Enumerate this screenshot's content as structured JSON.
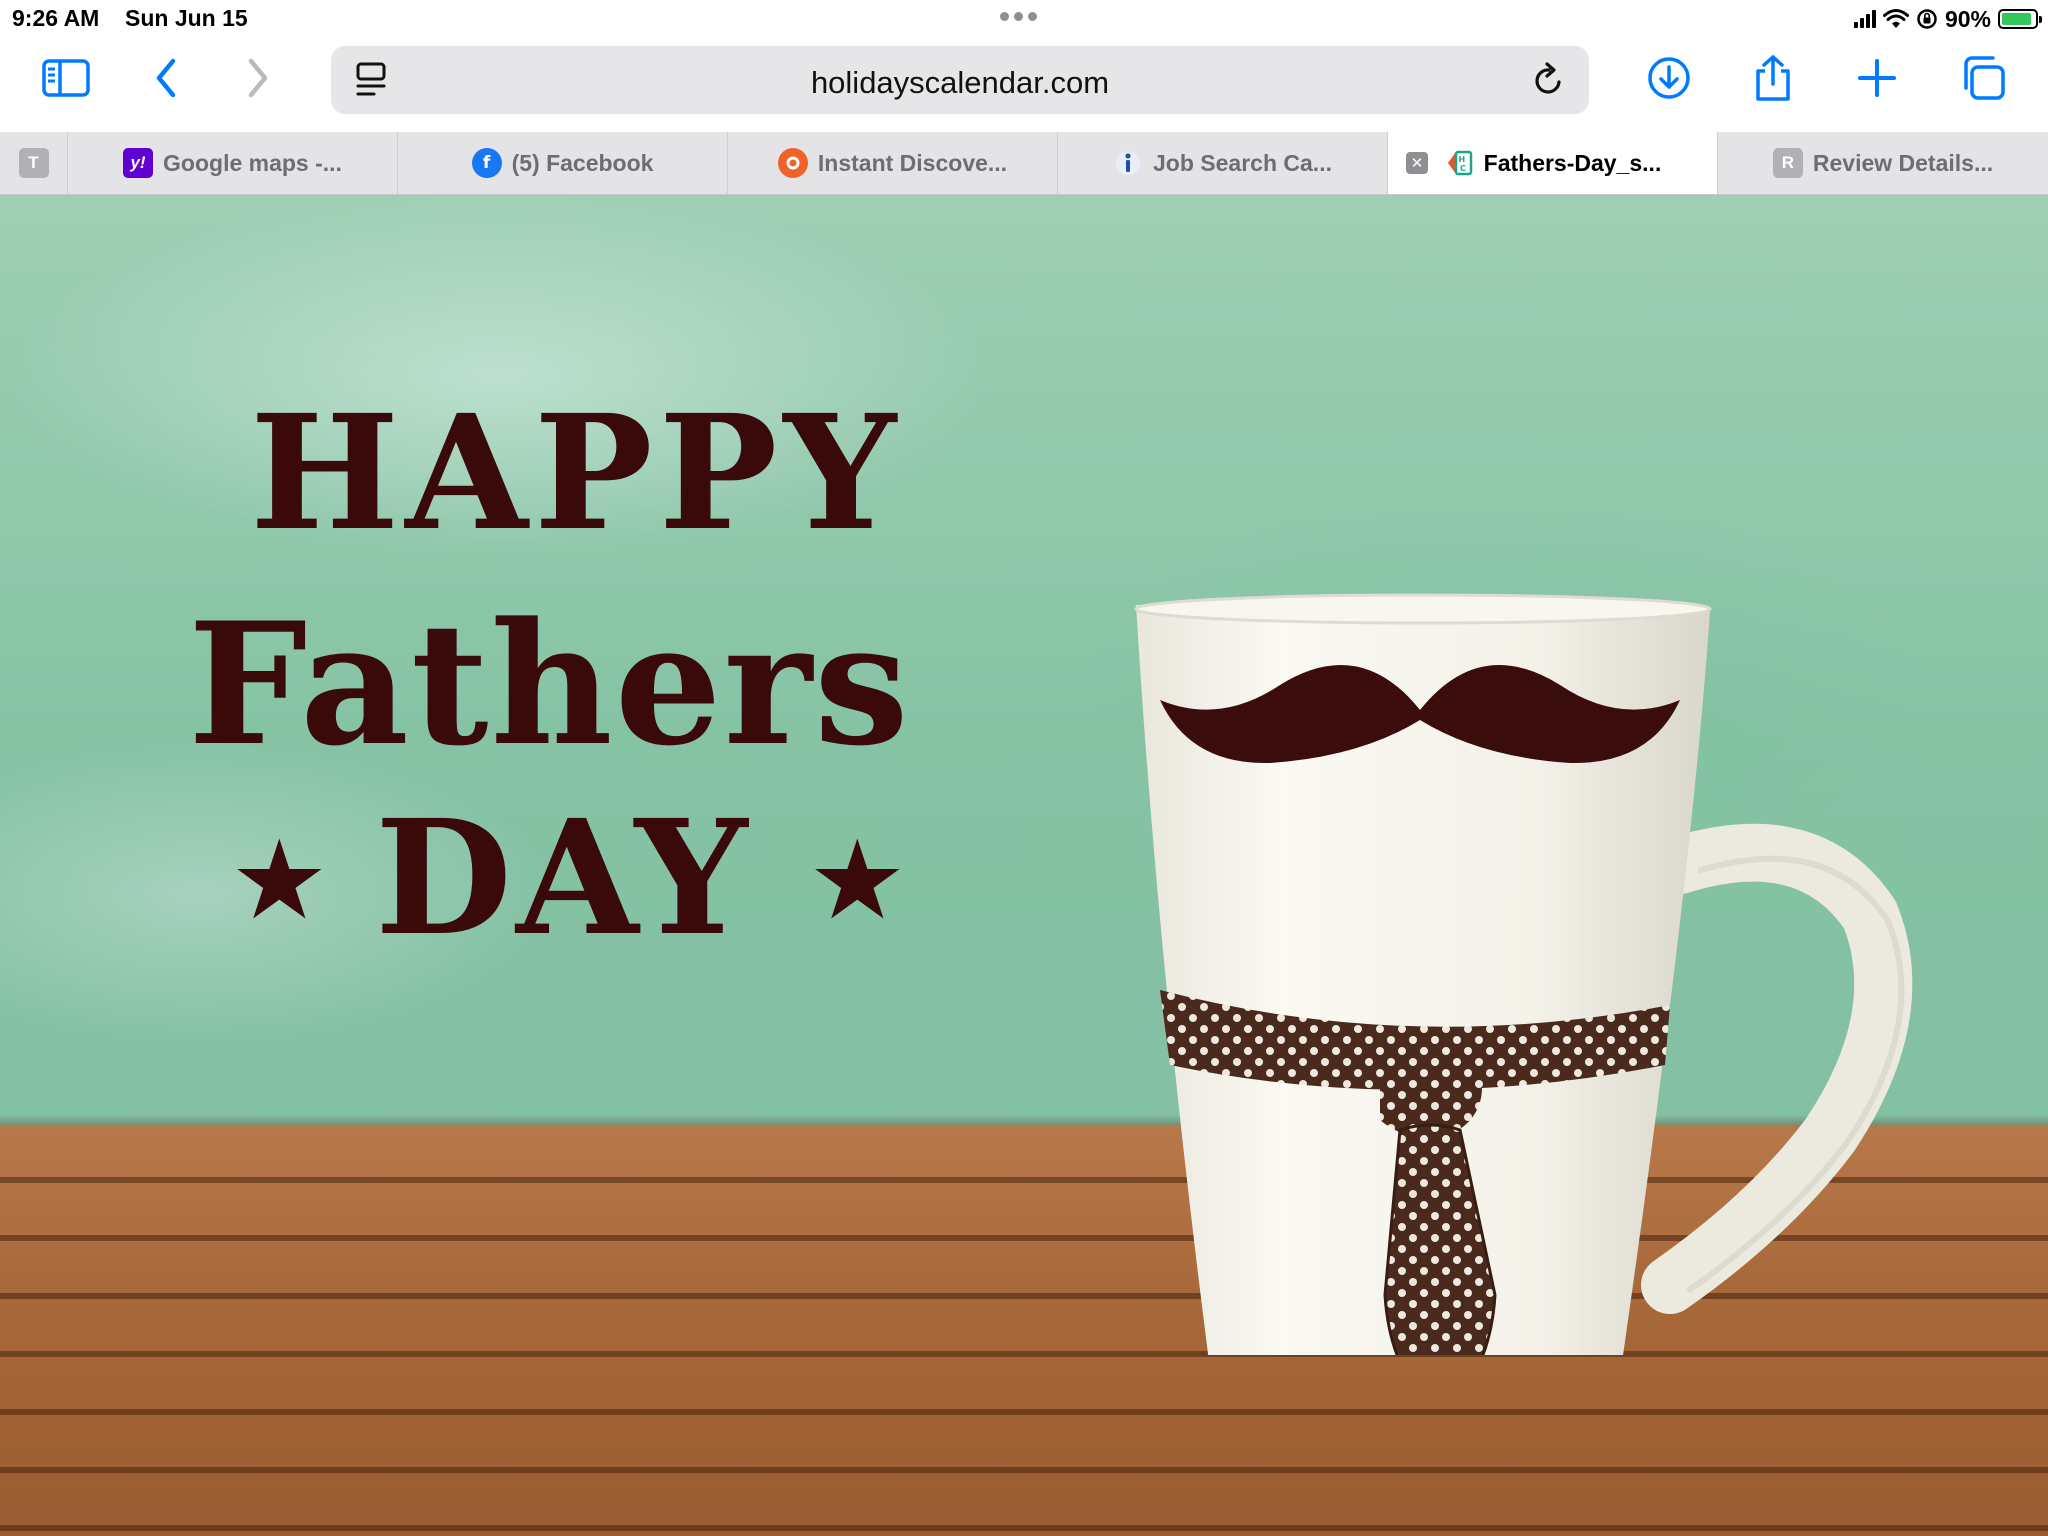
{
  "status_bar": {
    "time": "9:26 AM",
    "date": "Sun Jun 15",
    "battery_percent": "90%",
    "battery_level": 0.9,
    "battery_color": "#34c759"
  },
  "toolbar": {
    "sidebar_icon": "sidebar-icon",
    "back_icon": "chevron-left-icon",
    "forward_icon": "chevron-right-icon",
    "url": "holidayscalendar.com",
    "reader_icon": "page-menu-icon",
    "reload_icon": "reload-icon",
    "download_icon": "download-icon",
    "share_icon": "share-icon",
    "new_tab_icon": "plus-icon",
    "tabs_overview_icon": "tabs-icon",
    "accent_color": "#007aff"
  },
  "tabs": [
    {
      "favicon_letter": "T",
      "label": ""
    },
    {
      "favicon_letter": "y!",
      "label": "Google maps -..."
    },
    {
      "favicon_letter": "f",
      "label": "(5) Facebook"
    },
    {
      "favicon_letter": "",
      "label": "Instant Discove..."
    },
    {
      "favicon_letter": "i",
      "label": "Job Search Ca..."
    },
    {
      "favicon_letter": "",
      "label": "Fathers-Day_s...",
      "active": true
    },
    {
      "favicon_letter": "R",
      "label": "Review Details..."
    }
  ],
  "content": {
    "line1": "HAPPY",
    "line2": "Fathers",
    "line3": "DAY",
    "star": "★",
    "text_color": "#3a0a0a"
  }
}
